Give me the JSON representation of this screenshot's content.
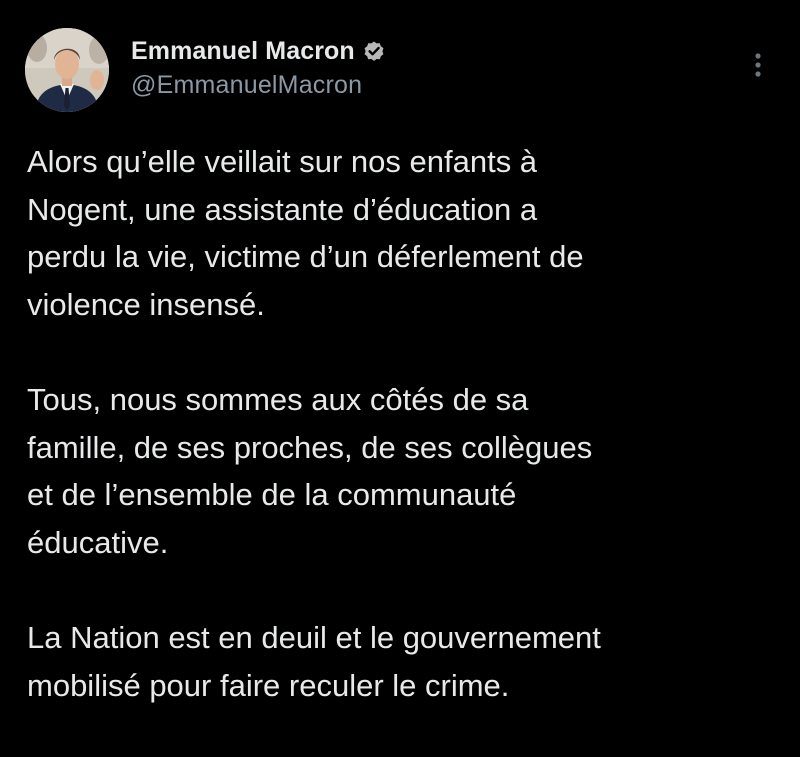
{
  "user": {
    "display_name": "Emmanuel Macron",
    "handle": "@EmmanuelMacron",
    "verified": true
  },
  "menu": {
    "icon": "more-vertical-icon"
  },
  "tweet": {
    "paragraphs": [
      "Alors qu’elle veillait sur nos enfants à\nNogent, une assistante d’éducation a\nperdu la vie, victime d’un déferlement de\nviolence insensé.",
      "Tous, nous sommes aux côtés de sa\nfamille, de ses proches, de ses collègues\net de l’ensemble de la communauté\néducative.",
      "La Nation est en deuil et le gouvernement\nmobilisé pour faire reculer le crime."
    ]
  },
  "colors": {
    "background": "#000000",
    "text": "#e7e9ea",
    "secondary": "#8b98a5",
    "verified_badge": "#b8b8b8"
  }
}
